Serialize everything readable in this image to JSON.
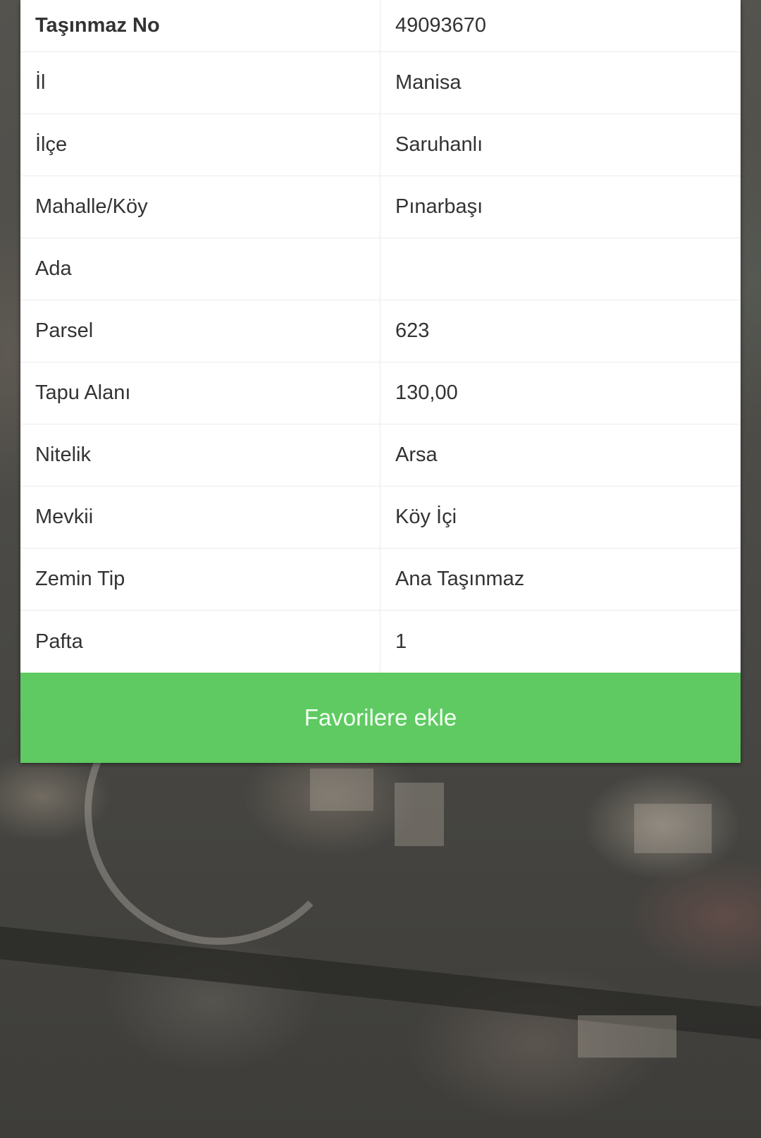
{
  "details": {
    "rows": [
      {
        "label": "Taşınmaz No",
        "value": "49093670"
      },
      {
        "label": "İl",
        "value": "Manisa"
      },
      {
        "label": "İlçe",
        "value": "Saruhanlı"
      },
      {
        "label": "Mahalle/Köy",
        "value": "Pınarbaşı"
      },
      {
        "label": "Ada",
        "value": ""
      },
      {
        "label": "Parsel",
        "value": "623"
      },
      {
        "label": "Tapu Alanı",
        "value": "130,00"
      },
      {
        "label": "Nitelik",
        "value": "Arsa"
      },
      {
        "label": "Mevkii",
        "value": "Köy İçi"
      },
      {
        "label": "Zemin Tip",
        "value": "Ana Taşınmaz"
      },
      {
        "label": "Pafta",
        "value": "1"
      }
    ]
  },
  "actions": {
    "favorite_label": "Favorilere ekle"
  },
  "colors": {
    "favorite_button": "#5fca62",
    "panel_background": "#ffffff"
  }
}
